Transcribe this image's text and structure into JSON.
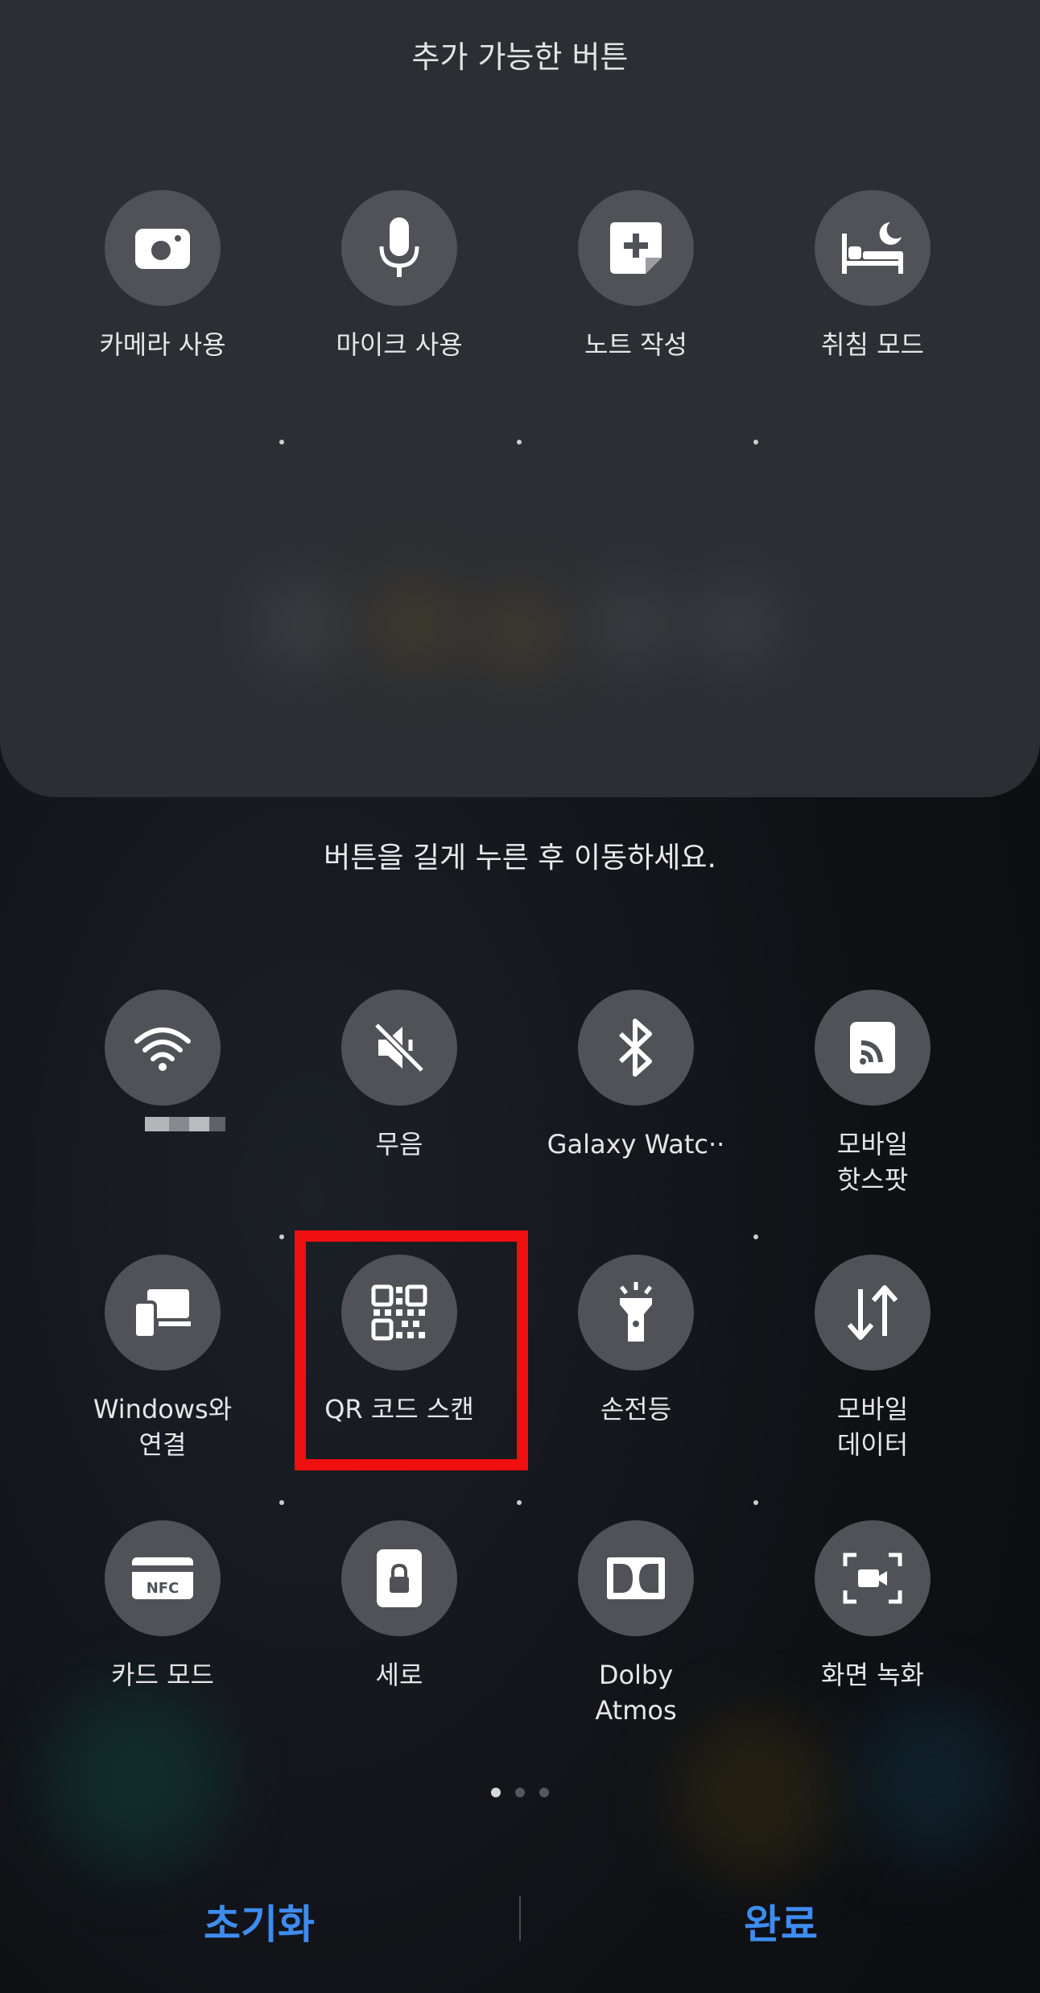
{
  "top_panel": {
    "title": "추가 가능한 버튼",
    "tiles": [
      {
        "label": "카메라 사용",
        "icon": "camera-icon"
      },
      {
        "label": "마이크 사용",
        "icon": "microphone-icon"
      },
      {
        "label": "노트 작성",
        "icon": "note-add-icon"
      },
      {
        "label": "취침 모드",
        "icon": "bed-moon-icon"
      }
    ]
  },
  "hint": "버튼을 길게 누른 후 이동하세요.",
  "active_tiles": [
    {
      "label": "",
      "icon": "wifi-icon"
    },
    {
      "label": "무음",
      "icon": "mute-icon"
    },
    {
      "label": "Galaxy Watc··",
      "icon": "bluetooth-icon"
    },
    {
      "label": "모바일\n핫스팟",
      "icon": "hotspot-icon"
    },
    {
      "label": "Windows와\n연결",
      "icon": "link-to-windows-icon"
    },
    {
      "label": "QR 코드 스캔",
      "icon": "qr-code-icon"
    },
    {
      "label": "손전등",
      "icon": "flashlight-icon"
    },
    {
      "label": "모바일\n데이터",
      "icon": "mobile-data-icon"
    },
    {
      "label": "카드 모드",
      "icon": "nfc-card-icon"
    },
    {
      "label": "세로",
      "icon": "portrait-lock-icon"
    },
    {
      "label": "Dolby\nAtmos",
      "icon": "dolby-icon"
    },
    {
      "label": "화면 녹화",
      "icon": "screen-record-icon"
    }
  ],
  "nfc_badge": "NFC",
  "pager": {
    "pages": 3,
    "current": 1
  },
  "footer": {
    "reset": "초기화",
    "done": "완료"
  },
  "colors": {
    "accent": "#3e8cf0",
    "highlight": "#f00f0f",
    "tile": "#505257"
  }
}
